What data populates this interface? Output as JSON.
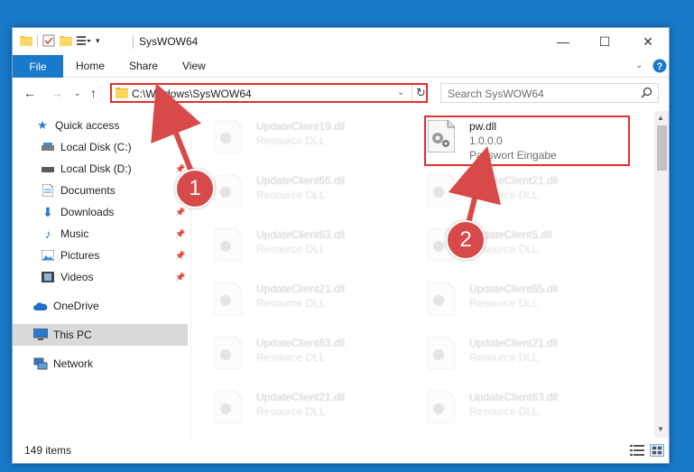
{
  "window": {
    "title": "SysWOW64",
    "controls": {
      "minimize": "—",
      "maximize": "☐",
      "close": "✕"
    }
  },
  "ribbon": {
    "tabs": [
      "File",
      "Home",
      "Share",
      "View"
    ]
  },
  "address_bar": {
    "path": "C:\\Windows\\SysWOW64"
  },
  "search": {
    "placeholder": "Search SysWOW64"
  },
  "nav_pane": {
    "items": [
      {
        "label": "Quick access",
        "icon": "star-icon",
        "pinned": false
      },
      {
        "label": "Local Disk (C:)",
        "icon": "drive-icon",
        "pinned": false
      },
      {
        "label": "Local Disk (D:)",
        "icon": "drive-icon",
        "pinned": true
      },
      {
        "label": "Documents",
        "icon": "document-icon",
        "pinned": true
      },
      {
        "label": "Downloads",
        "icon": "download-icon",
        "pinned": true
      },
      {
        "label": "Music",
        "icon": "music-icon",
        "pinned": true
      },
      {
        "label": "Pictures",
        "icon": "picture-icon",
        "pinned": true
      },
      {
        "label": "Videos",
        "icon": "video-icon",
        "pinned": true
      },
      {
        "label": "OneDrive",
        "icon": "cloud-icon",
        "pinned": false
      },
      {
        "label": "This PC",
        "icon": "computer-icon",
        "pinned": false,
        "selected": true
      },
      {
        "label": "Network",
        "icon": "network-icon",
        "pinned": false
      }
    ]
  },
  "files": {
    "highlighted": {
      "name": "pw.dll",
      "version": "1.0.0.0",
      "description": "Passwort Eingabe"
    },
    "faded": [
      {
        "name": "UpdateClient19.dll",
        "description": "Resource DLL"
      },
      {
        "name": "UpdateClient65.dll",
        "description": "Resource DLL"
      },
      {
        "name": "UpdateClient21.dll",
        "description": "Resource DLL"
      },
      {
        "name": "UpdateClient63.dll",
        "description": "Resource DLL"
      },
      {
        "name": "UpdateClient5.dll",
        "description": "Resource DLL"
      },
      {
        "name": "UpdateClient21.dll",
        "description": "Resource DLL"
      },
      {
        "name": "UpdateClient65.dll",
        "description": "Resource DLL"
      },
      {
        "name": "UpdateClient63.dll",
        "description": "Resource DLL"
      },
      {
        "name": "UpdateClient21.dll",
        "description": "Resource DLL"
      },
      {
        "name": "UpdateClient21.dll",
        "description": "Resource DLL"
      },
      {
        "name": "UpdateClient63.dll",
        "description": "Resource DLL"
      }
    ]
  },
  "status": {
    "item_count": "149 items"
  },
  "callouts": [
    "1",
    "2"
  ],
  "colors": {
    "accent": "#1979ca",
    "highlight": "#e03030",
    "callout": "#d84a4a"
  }
}
